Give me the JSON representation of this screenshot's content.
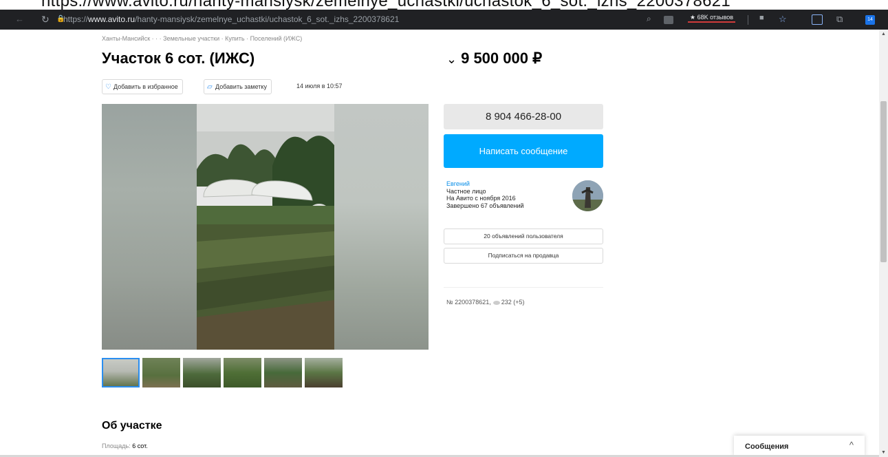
{
  "top_strip": {
    "text": "https://www.avito.ru/hanty-mansiysk/zemelnye_uchastki/uchastok_6_sot._izhs_2200378621"
  },
  "browser": {
    "url_prefix": "https://",
    "url_host": "www.avito.ru",
    "url_path": "/hanty-mansiysk/zemelnye_uchastki/uchastok_6_sot._izhs_2200378621",
    "rating_chip": "★ 68K отзывов",
    "ext_badge": "14"
  },
  "breadcrumbs": "Ханты-Мансийск · · · Земельные участки · Купить · Поселений (ИЖС)",
  "listing": {
    "title": "Участок 6 сот. (ИЖС)",
    "price": "9 500 000 ₽",
    "add_favorite": "Добавить в избранное",
    "add_note": "Добавить заметку",
    "date": "14 июля в 10:57",
    "section_title": "Об участке",
    "param_label": "Площадь:",
    "param_value": "6 сот.",
    "meta_number": "№ 2200378621,",
    "meta_views": "232 (+5)"
  },
  "contact": {
    "phone": "8 904 466-28-00",
    "write_message": "Написать сообщение"
  },
  "seller": {
    "name": "Евгений",
    "type": "Частное лицо",
    "since": "На Авито с ноября 2016",
    "completed": "Завершено 67 объявлений",
    "listings_btn": "20 объявлений пользователя",
    "subscribe_btn": "Подписаться на продавца"
  },
  "messenger": {
    "label": "Сообщения",
    "chevron": "^"
  },
  "colors": {
    "accent": "#00aaff",
    "link": "#0a8fe8",
    "browser_bar": "#202124"
  },
  "icons": [
    "back-icon",
    "reload-icon",
    "lock-icon",
    "search-icon",
    "bookmark-icon",
    "collections-icon",
    "extensions-icon",
    "heart-icon",
    "note-icon",
    "eye-icon",
    "chevron-up-icon"
  ]
}
